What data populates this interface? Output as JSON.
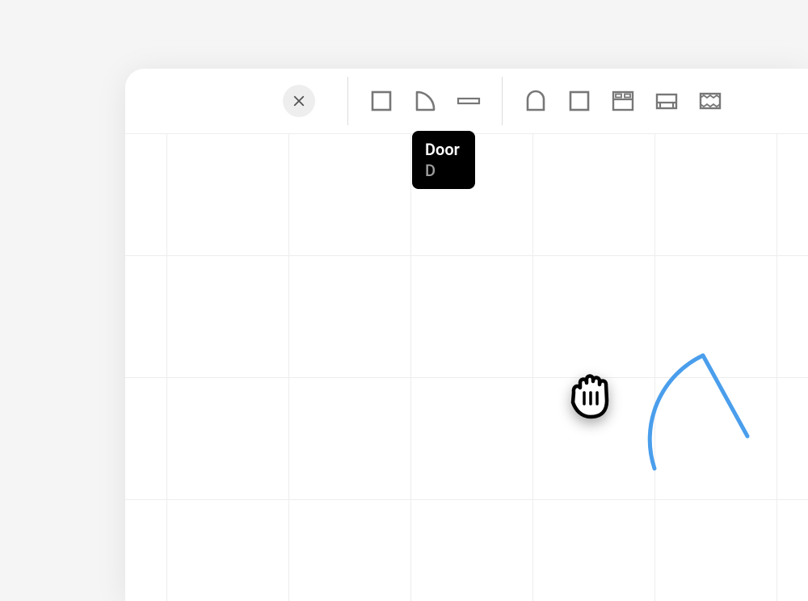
{
  "tooltip": {
    "title": "Door",
    "shortcut": "D"
  },
  "tools": {
    "close": "close",
    "room": "room",
    "door": "door",
    "window": "window",
    "arch": "arch",
    "square": "square",
    "bed": "bed",
    "sofa": "sofa",
    "rug": "rug"
  },
  "colors": {
    "doorStroke": "#4a9eec",
    "iconStroke": "#777777",
    "grid": "#ededed"
  }
}
